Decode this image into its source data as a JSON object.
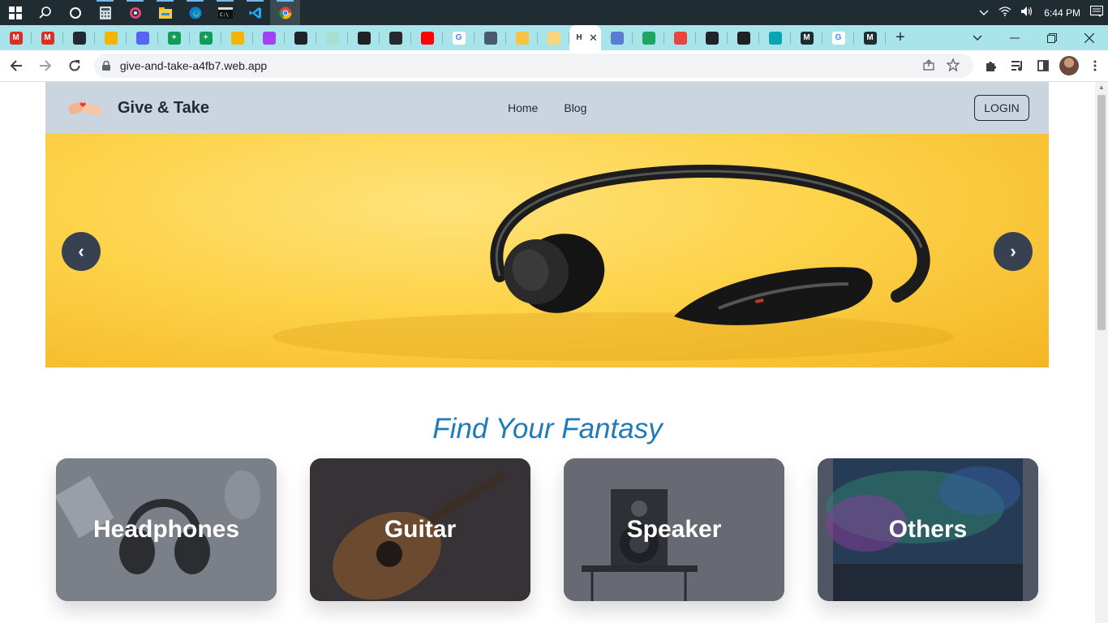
{
  "taskbar": {
    "time": "6:44 PM",
    "apps": [
      "start-icon",
      "search-icon",
      "cortana-icon",
      "calculator-icon",
      "media-icon",
      "file-explorer-icon",
      "edge-icon",
      "terminal-icon",
      "vscode-icon",
      "chrome-icon"
    ]
  },
  "browser": {
    "tabs": [
      {
        "icon": "gmail-icon",
        "color": "#d93025",
        "glyph": "M"
      },
      {
        "icon": "gmail-icon",
        "color": "#d93025",
        "glyph": "M"
      },
      {
        "icon": "github-icon",
        "color": "#24292f",
        "glyph": ""
      },
      {
        "icon": "slides-icon",
        "color": "#f4b400",
        "glyph": ""
      },
      {
        "icon": "discord-icon",
        "color": "#5865f2",
        "glyph": ""
      },
      {
        "icon": "sheets-icon",
        "color": "#0f9d58",
        "glyph": "+"
      },
      {
        "icon": "sheets-icon",
        "color": "#0f9d58",
        "glyph": "+"
      },
      {
        "icon": "slides-icon",
        "color": "#f4b400",
        "glyph": ""
      },
      {
        "icon": "video-icon",
        "color": "#a142f4",
        "glyph": ""
      },
      {
        "icon": "react-icon",
        "color": "#20232a",
        "glyph": ""
      },
      {
        "icon": "chat-icon",
        "color": "#a9dfd3",
        "glyph": ""
      },
      {
        "icon": "globe-icon",
        "color": "#202124",
        "glyph": ""
      },
      {
        "icon": "github-icon",
        "color": "#24292f",
        "glyph": ""
      },
      {
        "icon": "youtube-icon",
        "color": "#ff0000",
        "glyph": ""
      },
      {
        "icon": "google-icon",
        "color": "#ffffff",
        "glyph": "G"
      },
      {
        "icon": "graduation-icon",
        "color": "#4a5a6a",
        "glyph": ""
      },
      {
        "icon": "flower-icon",
        "color": "#f6c342",
        "glyph": ""
      },
      {
        "icon": "bulb-icon",
        "color": "#f9d67a",
        "glyph": ""
      },
      {
        "icon": "page-icon",
        "color": "#ffffff",
        "glyph": "H",
        "active": true
      },
      {
        "icon": "lvl-icon",
        "color": "#5b7bd5",
        "glyph": ""
      },
      {
        "icon": "drive-icon",
        "color": "#1fa463",
        "glyph": ""
      },
      {
        "icon": "arrow-icon",
        "color": "#e8453c",
        "glyph": ""
      },
      {
        "icon": "react-icon",
        "color": "#20232a",
        "glyph": ""
      },
      {
        "icon": "globe-icon",
        "color": "#202124",
        "glyph": ""
      },
      {
        "icon": "diamond-icon",
        "color": "#0aa5b5",
        "glyph": ""
      },
      {
        "icon": "m-icon",
        "color": "#1f2d33",
        "glyph": "M"
      },
      {
        "icon": "google-icon",
        "color": "#ffffff",
        "glyph": "G"
      },
      {
        "icon": "m-icon",
        "color": "#1f2d33",
        "glyph": "M"
      }
    ],
    "url": "give-and-take-a4fb7.web.app"
  },
  "site": {
    "brand": "Give & Take",
    "nav": {
      "home": "Home",
      "blog": "Blog"
    },
    "login": "LOGIN",
    "carousel": {
      "prev": "‹",
      "next": "›"
    },
    "heading": "Find Your Fantasy",
    "categories": [
      {
        "label": "Headphones"
      },
      {
        "label": "Guitar"
      },
      {
        "label": "Speaker"
      },
      {
        "label": "Others"
      }
    ]
  }
}
